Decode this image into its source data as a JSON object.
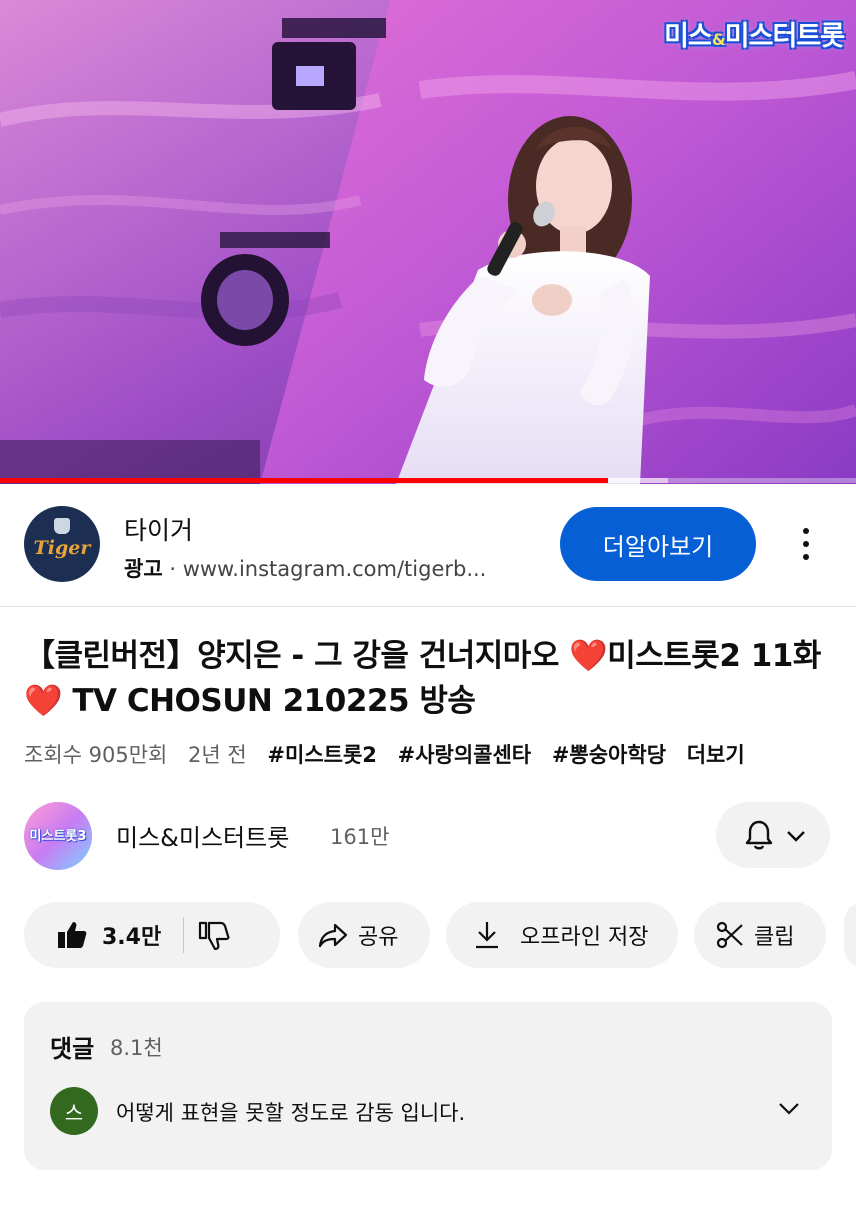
{
  "player": {
    "show_logo_left": "미스",
    "show_logo_amp": "&",
    "show_logo_right": "미스터트롯",
    "progress_fraction": 0.71,
    "buffer_fraction": 0.78
  },
  "ad": {
    "logo_text": "Tiger",
    "advertiser": "타이거",
    "label": "광고",
    "separator": "·",
    "url": "www.instagram.com/tigerb...",
    "cta": "더알아보기",
    "icons": {
      "more": "more-vert-icon"
    }
  },
  "video": {
    "title_part1": "【클린버전】양지은 - 그 강을 건너지마오 ",
    "heart": "❤️",
    "title_part2": "미스트롯2 11화",
    "title_part3": " TV CHOSUN 210225 방송",
    "views": "조회수 905만회",
    "age": "2년 전",
    "tags": [
      "#미스트롯2",
      "#사랑의콜센타",
      "#뽕숭아학당"
    ],
    "more": "더보기"
  },
  "channel": {
    "avatar_text": "미스트롯3",
    "name": "미스&미스터트롯",
    "subscribers": "161만",
    "icons": {
      "bell": "bell-icon",
      "chevron": "chevron-down-icon"
    }
  },
  "actions": {
    "likes": "3.4만",
    "share": "공유",
    "save": "오프라인 저장",
    "clip": "클립",
    "icons": {
      "like": "thumb-up-icon",
      "dislike": "thumb-down-icon",
      "share": "share-icon",
      "save": "download-icon",
      "clip": "scissors-icon"
    }
  },
  "comments": {
    "title": "댓글",
    "count": "8.1천",
    "avatar_letter": "스",
    "first_comment": "어떻게 표현을 못할 정도로 감동 입니다.",
    "accent_color": "#33691e"
  },
  "colors": {
    "cta_blue": "#065fd4",
    "progress_red": "#ff0000",
    "pill_gray": "#f2f2f2"
  }
}
